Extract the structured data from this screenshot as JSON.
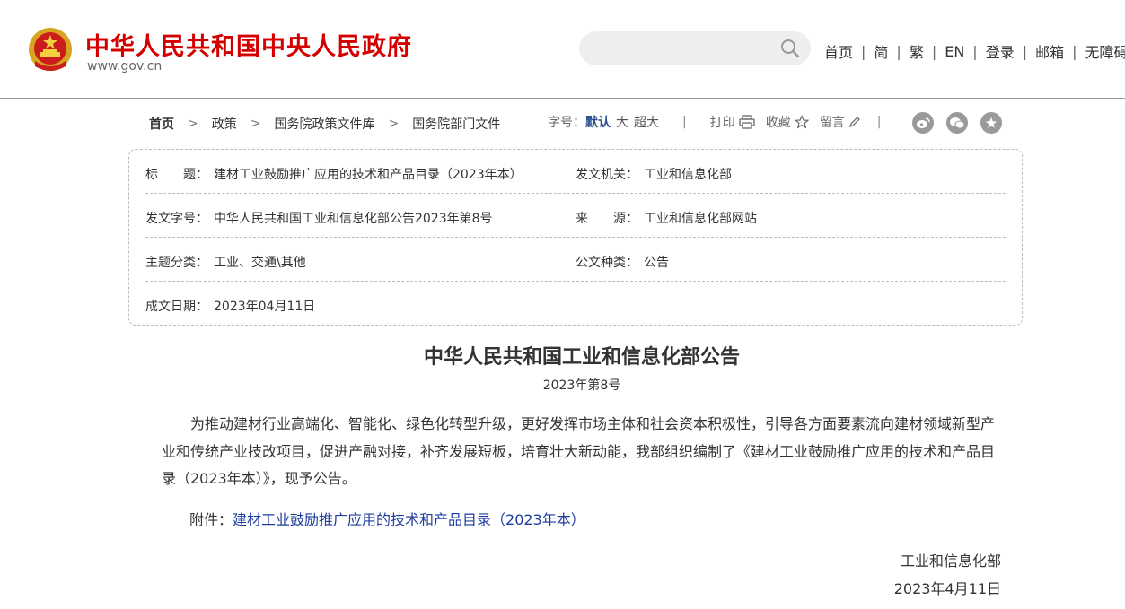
{
  "header": {
    "site_title": "中华人民共和国中央人民政府",
    "site_domain": "www.gov.cn",
    "search_placeholder": "",
    "nav": [
      "首页",
      "简",
      "繁",
      "EN",
      "登录",
      "邮箱",
      "无障碍"
    ],
    "nav_separator": "|",
    "brand_color": "#d40000"
  },
  "breadcrumb": {
    "items": [
      "首页",
      "政策",
      "国务院政策文件库",
      "国务院部门文件"
    ],
    "arrow": ">"
  },
  "toolbar": {
    "font_size_label": "字号：",
    "font_sizes": [
      "默认",
      "大",
      "超大"
    ],
    "separator": "|",
    "print_label": "打印",
    "favorite_label": "收藏",
    "comment_label": "留言",
    "share_icons": [
      "weibo-icon",
      "wechat-icon",
      "star-icon"
    ]
  },
  "info": {
    "title_label": "标　　题：",
    "title_value": "建材工业鼓励推广应用的技术和产品目录（2023年本）",
    "issuer_label": "发文机关：",
    "issuer_value": "工业和信息化部",
    "doc_no_label": "发文字号：",
    "doc_no_value": "中华人民共和国工业和信息化部公告2023年第8号",
    "source_label": "来　　源：",
    "source_value": "工业和信息化部网站",
    "topic_label": "主题分类：",
    "topic_value": "工业、交通\\其他",
    "type_label": "公文种类：",
    "type_value": "公告",
    "date_label": "成文日期：",
    "date_value": "2023年04月11日"
  },
  "document": {
    "title": "中华人民共和国工业和信息化部公告",
    "number": "2023年第8号",
    "paragraph": "为推动建材行业高端化、智能化、绿色化转型升级，更好发挥市场主体和社会资本积极性，引导各方面要素流向建材领域新型产业和传统产业技改项目，促进产融对接，补齐发展短板，培育壮大新动能，我部组织编制了《建材工业鼓励推广应用的技术和产品目录（2023年本）》，现予公告。",
    "attachment_label": "附件：",
    "attachment_link": "建材工业鼓励推广应用的技术和产品目录（2023年本）",
    "issuer": "工业和信息化部",
    "date": "2023年4月11日",
    "link_color": "#1e3ca0"
  }
}
